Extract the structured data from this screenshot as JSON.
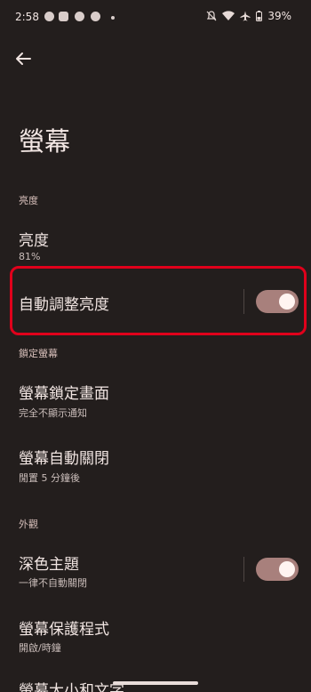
{
  "status_bar": {
    "time": "2:58",
    "battery": "39%",
    "icons": [
      "messenger-icon",
      "youtube-icon",
      "chrome-icon",
      "chrome-icon",
      "dot-icon",
      "notifications-off-icon",
      "wifi-icon",
      "airplane-icon",
      "battery-icon"
    ]
  },
  "page": {
    "title": "螢幕"
  },
  "sections": {
    "brightness": {
      "header": "亮度",
      "brightness_level": {
        "title": "亮度",
        "value": "81%"
      },
      "adaptive_brightness": {
        "title": "自動調整亮度",
        "enabled": true
      }
    },
    "lock_screen": {
      "header": "鎖定螢幕",
      "lock_screen_display": {
        "title": "螢幕鎖定畫面",
        "summary": "完全不顯示通知"
      },
      "screen_timeout": {
        "title": "螢幕自動關閉",
        "summary": "閒置 5 分鐘後"
      }
    },
    "appearance": {
      "header": "外觀",
      "dark_theme": {
        "title": "深色主題",
        "summary": "一律不自動關閉",
        "enabled": true
      },
      "screen_saver": {
        "title": "螢幕保護程式",
        "summary": "開啟/時鐘"
      },
      "display_size": {
        "title": "螢幕大小和文字"
      }
    }
  },
  "colors": {
    "background": "#231e1d",
    "toggle_on": "#a8807c",
    "highlight": "#e0001b"
  }
}
